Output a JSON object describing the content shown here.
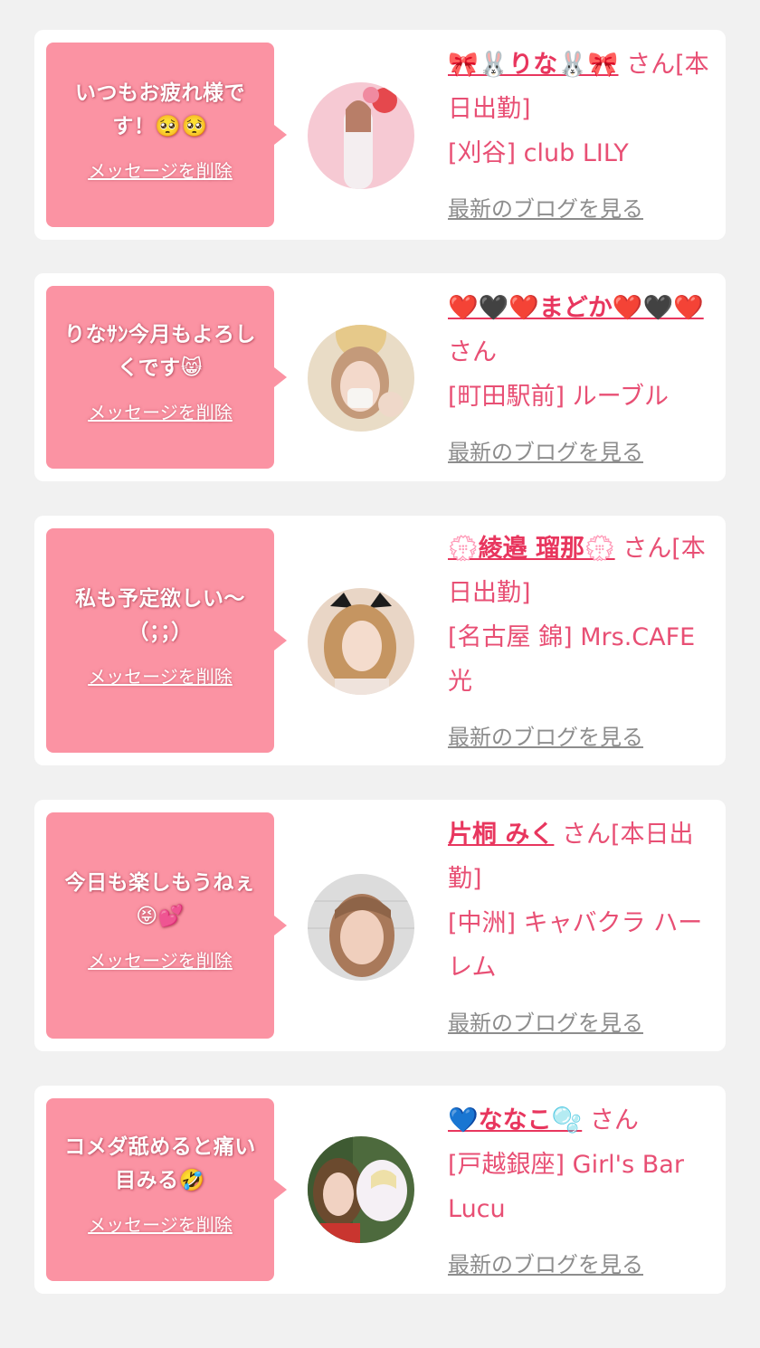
{
  "colors": {
    "page_bg": "#f1f1f1",
    "card_bg": "#ffffff",
    "bubble_bg": "#fb93a3",
    "accent_text": "#e84f74",
    "link_gray": "#8d8d8d"
  },
  "messages": [
    {
      "text": "いつもお疲れ様です！🥺🥺",
      "delete_label": "メッセージを削除",
      "name": "🎀🐰りな🐰🎀",
      "suffix": "さん[本日出勤]",
      "shop": "[刈谷] club LILY",
      "blog_label": "最新のブログを見る"
    },
    {
      "text": "りなｻﾝ今月もよろしくです😸",
      "delete_label": "メッセージを削除",
      "name": "❤️🖤❤️まどか❤️🖤❤️",
      "suffix": "さん",
      "shop": "[町田駅前] ルーブル",
      "blog_label": "最新のブログを見る"
    },
    {
      "text": "私も予定欲しい〜（；；）",
      "delete_label": "メッセージを削除",
      "name": "💮綾邉 瑠那💮",
      "suffix": "さん[本日出勤]",
      "shop": "[名古屋 錦] Mrs.CAFE 光",
      "blog_label": "最新のブログを見る"
    },
    {
      "text": "今日も楽しもうねぇ😝💕",
      "delete_label": "メッセージを削除",
      "name": "片桐 みく",
      "suffix": "さん[本日出勤]",
      "shop": "[中洲] キャバクラ ハーレム",
      "blog_label": "最新のブログを見る"
    },
    {
      "text": "コメダ舐めると痛い目みる🤣",
      "delete_label": "メッセージを削除",
      "name": "💙ななこ🫧",
      "suffix": "さん",
      "shop": "[戸越銀座] Girl's Bar Lucu",
      "blog_label": "最新のブログを見る"
    }
  ]
}
